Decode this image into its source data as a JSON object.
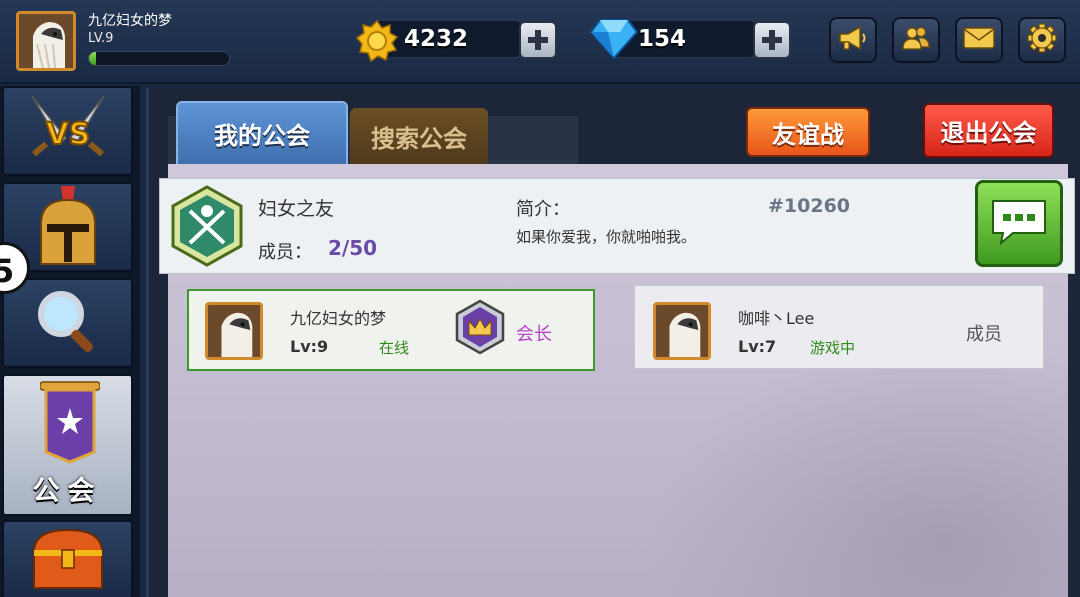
{
  "player": {
    "name": "九亿妇女的梦",
    "level": "LV.9",
    "xp_fraction": 0.05
  },
  "resources": {
    "gold": "4232",
    "gems": "154"
  },
  "top_icons": [
    "megaphone-icon",
    "friends-icon",
    "mail-icon",
    "settings-gear-icon"
  ],
  "sidebar": {
    "items": [
      {
        "name": "vs-battle",
        "label": ""
      },
      {
        "name": "hero-helmet",
        "label": ""
      },
      {
        "name": "search",
        "label": ""
      },
      {
        "name": "guild",
        "label": "公会",
        "active": true
      },
      {
        "name": "treasure-chest",
        "label": ""
      }
    ],
    "badge": "5"
  },
  "tabs": {
    "my_guild": "我的公会",
    "search_guild": "搜索公会"
  },
  "buttons": {
    "friendly_battle": "友谊战",
    "leave_guild": "退出公会"
  },
  "guild": {
    "name": "妇女之友",
    "members_label": "成员：",
    "members_value": "2/50",
    "intro_label": "简介：",
    "intro_text": "如果你爱我，你就啪啪我。",
    "id": "#10260"
  },
  "members": [
    {
      "name": "九亿妇女的梦",
      "level": "Lv:9",
      "status": "在线",
      "role": "会长"
    },
    {
      "name": "咖啡丶Lee",
      "level": "Lv:7",
      "status": "游戏中",
      "role": "成员"
    }
  ],
  "colors": {
    "accent_green": "#3f9a1f",
    "leader_purple": "#b544c9",
    "button_orange": "#e7551a",
    "button_red": "#d7251a"
  }
}
